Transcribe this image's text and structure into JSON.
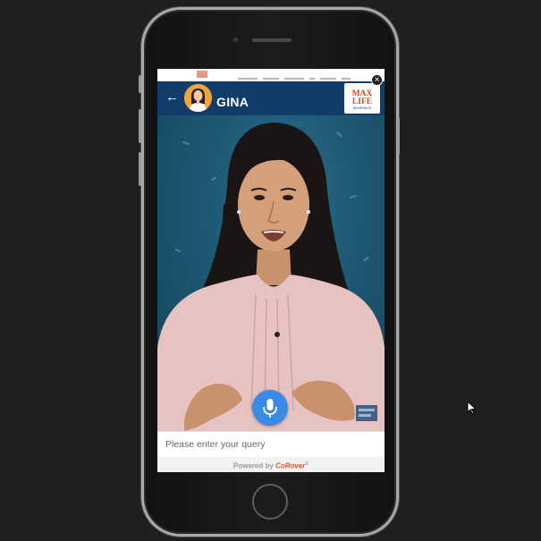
{
  "chat": {
    "bot_name": "GINA",
    "back_label": "←",
    "close_label": "×",
    "input_placeholder": "Please enter your query",
    "powered_by_label": "Powered by",
    "powered_by_brand": "CoRover",
    "powered_by_mark": "®"
  },
  "brand_logo": {
    "line1": "MAX",
    "line2": "LIFE",
    "line3": "INSURANCE"
  },
  "icons": {
    "back": "arrow-left-icon",
    "mic": "microphone-icon",
    "close": "close-icon",
    "cursor": "mouse-pointer-icon"
  },
  "colors": {
    "header": "#123d6b",
    "mic_button": "#3a8ae6",
    "brand_red": "#c8462b",
    "corover_orange": "#e05522"
  }
}
